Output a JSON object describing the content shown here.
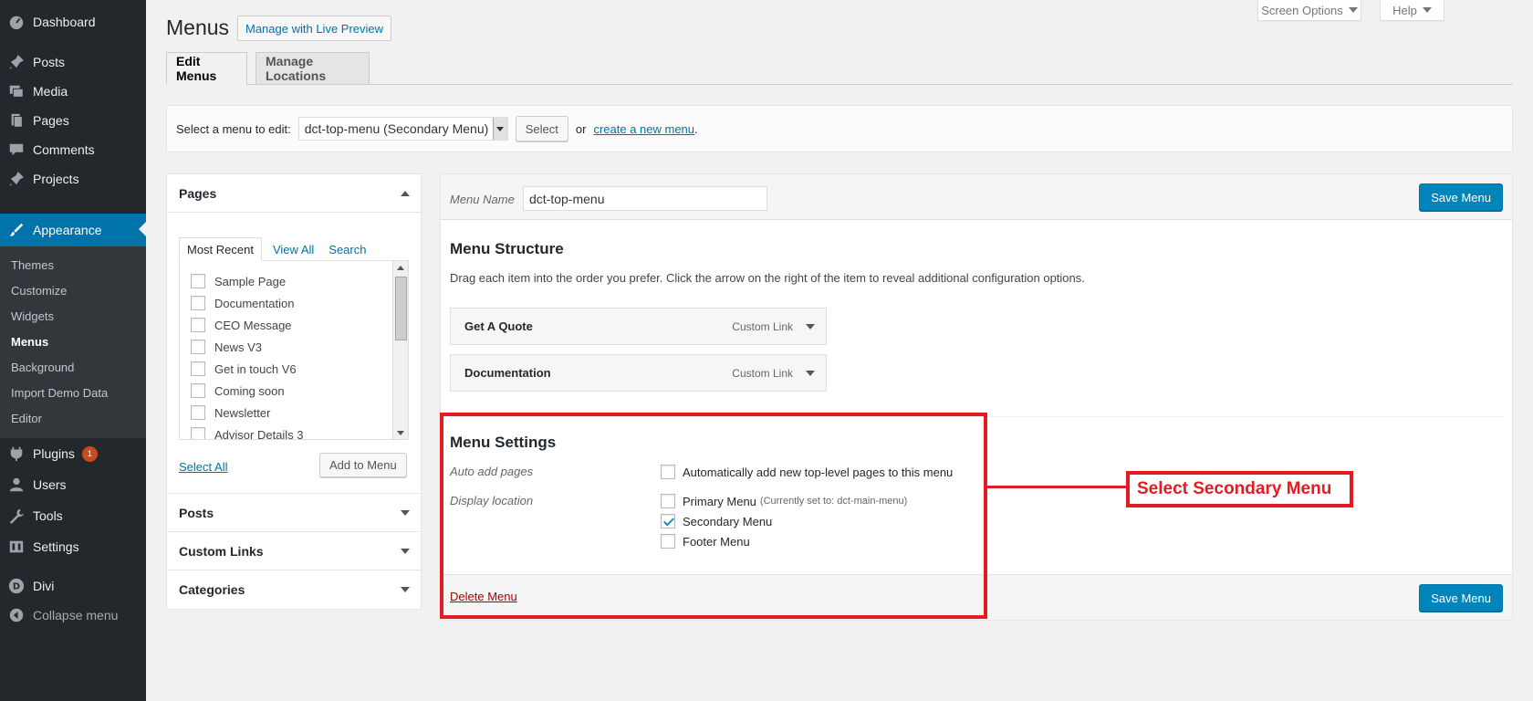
{
  "sidebar": {
    "items": [
      {
        "label": "Dashboard",
        "icon": "dashboard-icon"
      },
      {
        "label": "Posts",
        "icon": "pin-icon"
      },
      {
        "label": "Media",
        "icon": "media-icon"
      },
      {
        "label": "Pages",
        "icon": "pages-icon"
      },
      {
        "label": "Comments",
        "icon": "comment-icon"
      },
      {
        "label": "Projects",
        "icon": "pin-icon"
      },
      {
        "label": "Appearance",
        "icon": "brush-icon"
      },
      {
        "label": "Plugins",
        "icon": "plug-icon",
        "badge": "1"
      },
      {
        "label": "Users",
        "icon": "user-icon"
      },
      {
        "label": "Tools",
        "icon": "wrench-icon"
      },
      {
        "label": "Settings",
        "icon": "settings-icon"
      },
      {
        "label": "Divi",
        "icon": "divi-icon"
      },
      {
        "label": "Collapse menu",
        "icon": "collapse-icon"
      }
    ],
    "submenu": [
      "Themes",
      "Customize",
      "Widgets",
      "Menus",
      "Background",
      "Import Demo Data",
      "Editor"
    ]
  },
  "top": {
    "screen_options": "Screen Options",
    "help": "Help"
  },
  "header": {
    "title": "Menus",
    "live_preview": "Manage with Live Preview"
  },
  "tabs": [
    "Edit Menus",
    "Manage Locations"
  ],
  "manage": {
    "label": "Select a menu to edit:",
    "selected": "dct-top-menu (Secondary Menu)",
    "select_btn": "Select",
    "or": "or",
    "create_link": "create a new menu",
    "period": "."
  },
  "left": {
    "pages_title": "Pages",
    "page_tabs": [
      "Most Recent",
      "View All",
      "Search"
    ],
    "pages": [
      "Sample Page",
      "Documentation",
      "CEO Message",
      "News V3",
      "Get in touch V6",
      "Coming soon",
      "Newsletter",
      "Advisor Details 3"
    ],
    "select_all": "Select All",
    "add_to_menu": "Add to Menu",
    "sections": [
      "Posts",
      "Custom Links",
      "Categories"
    ]
  },
  "menu": {
    "name_label": "Menu Name",
    "name_value": "dct-top-menu",
    "save": "Save Menu",
    "structure_title": "Menu Structure",
    "structure_desc": "Drag each item into the order you prefer. Click the arrow on the right of the item to reveal additional configuration options.",
    "items": [
      {
        "title": "Get A Quote",
        "type": "Custom Link"
      },
      {
        "title": "Documentation",
        "type": "Custom Link"
      }
    ],
    "settings_title": "Menu Settings",
    "auto_add_label": "Auto add pages",
    "auto_add_text": "Automatically add new top-level pages to this menu",
    "display_label": "Display location",
    "locations": [
      {
        "label": "Primary Menu",
        "note": "(Currently set to: dct-main-menu)",
        "checked": false
      },
      {
        "label": "Secondary Menu",
        "note": "",
        "checked": true
      },
      {
        "label": "Footer Menu",
        "note": "",
        "checked": false
      }
    ],
    "delete": "Delete Menu"
  },
  "annotation": {
    "text": "Select Secondary Menu",
    "color": "#e31b23"
  },
  "colors": {
    "sidebar": "#23282d",
    "accent": "#0073aa",
    "primary_button": "#0085ba"
  }
}
